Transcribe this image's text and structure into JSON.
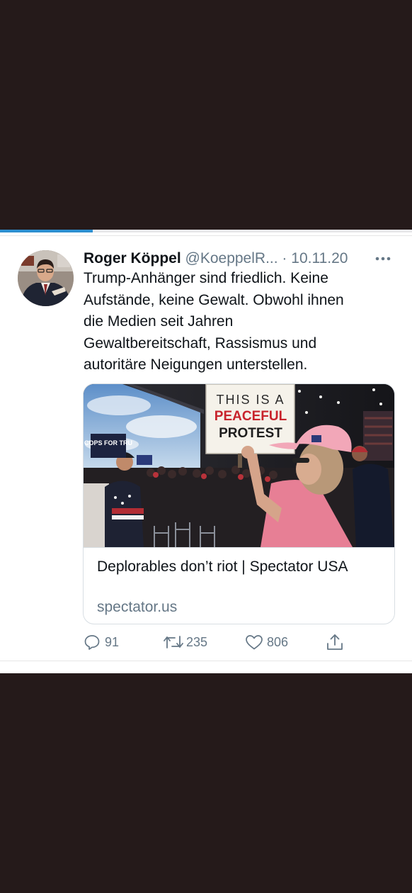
{
  "video_progress": {
    "fraction": 0.225,
    "color": "#2d8fd0"
  },
  "tweet": {
    "author_name": "Roger Köppel",
    "handle": "@KoeppelR...",
    "separator": "·",
    "date": "10.11.20",
    "more_icon": "more-horizontal-icon",
    "text": "Trump-Anhänger sind friedlich. Keine\nAufstände, keine Gewalt. Obwohl ihnen\ndie Medien seit Jahren\nGewaltbereitschaft, Rassismus und\nautoritäre Neigungen unterstellen.",
    "link_card": {
      "image_sign": {
        "line1": "THIS IS A",
        "line2": "PEACEFUL",
        "line3": "PROTEST"
      },
      "image_small_sign": "COPS FOR TRU",
      "title": "Deplorables don’t riot | Spectator USA",
      "domain": "spectator.us"
    },
    "actions": {
      "reply": {
        "icon": "reply-icon",
        "count": "91"
      },
      "retweet": {
        "icon": "retweet-icon",
        "count": "235"
      },
      "like": {
        "icon": "heart-icon",
        "count": "806"
      },
      "share": {
        "icon": "share-icon"
      }
    }
  },
  "colors": {
    "background_dark": "#251a1a",
    "text_primary": "#0f1419",
    "text_secondary": "#657786",
    "border": "#d8dee3"
  }
}
